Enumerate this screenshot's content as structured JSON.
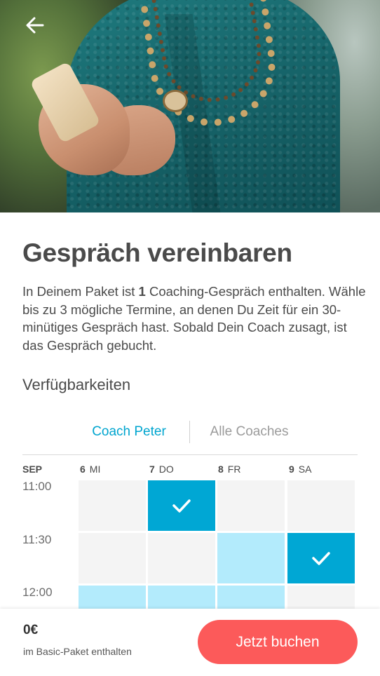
{
  "header": {
    "back_icon": "arrow-left-icon"
  },
  "page": {
    "title": "Gespräch vereinbaren",
    "description_before": "In Deinem Paket ist ",
    "description_count": "1",
    "description_after": " Coaching-Gespräch enthalten. Wähle bis zu 3 mögliche Termine, an denen Du Zeit für ein 30-minütiges Gespräch hast. Sobald Dein Coach zusagt, ist das Gespräch gebucht.",
    "section_title": "Verfügbarkeiten"
  },
  "tabs": [
    {
      "label": "Coach Peter",
      "active": true
    },
    {
      "label": "Alle Coaches",
      "active": false
    }
  ],
  "calendar": {
    "month": "SEP",
    "days": [
      {
        "num": "6",
        "label": "MI"
      },
      {
        "num": "7",
        "label": "DO"
      },
      {
        "num": "8",
        "label": "FR"
      },
      {
        "num": "9",
        "label": "SA"
      }
    ],
    "times": [
      "11:00",
      "11:30",
      "12:00"
    ],
    "slots": [
      [
        "unavailable",
        "selected",
        "unavailable",
        "unavailable"
      ],
      [
        "unavailable",
        "unavailable",
        "available",
        "selected"
      ],
      [
        "available",
        "available",
        "available",
        "unavailable"
      ]
    ],
    "colors": {
      "selected": "#00a7d4",
      "available": "#b3ebfc",
      "unavailable": "#f4f4f4"
    }
  },
  "footer": {
    "price": "0€",
    "price_note": "im Basic-Paket enthalten",
    "cta_label": "Jetzt buchen",
    "cta_color": "#fc5a5a"
  }
}
